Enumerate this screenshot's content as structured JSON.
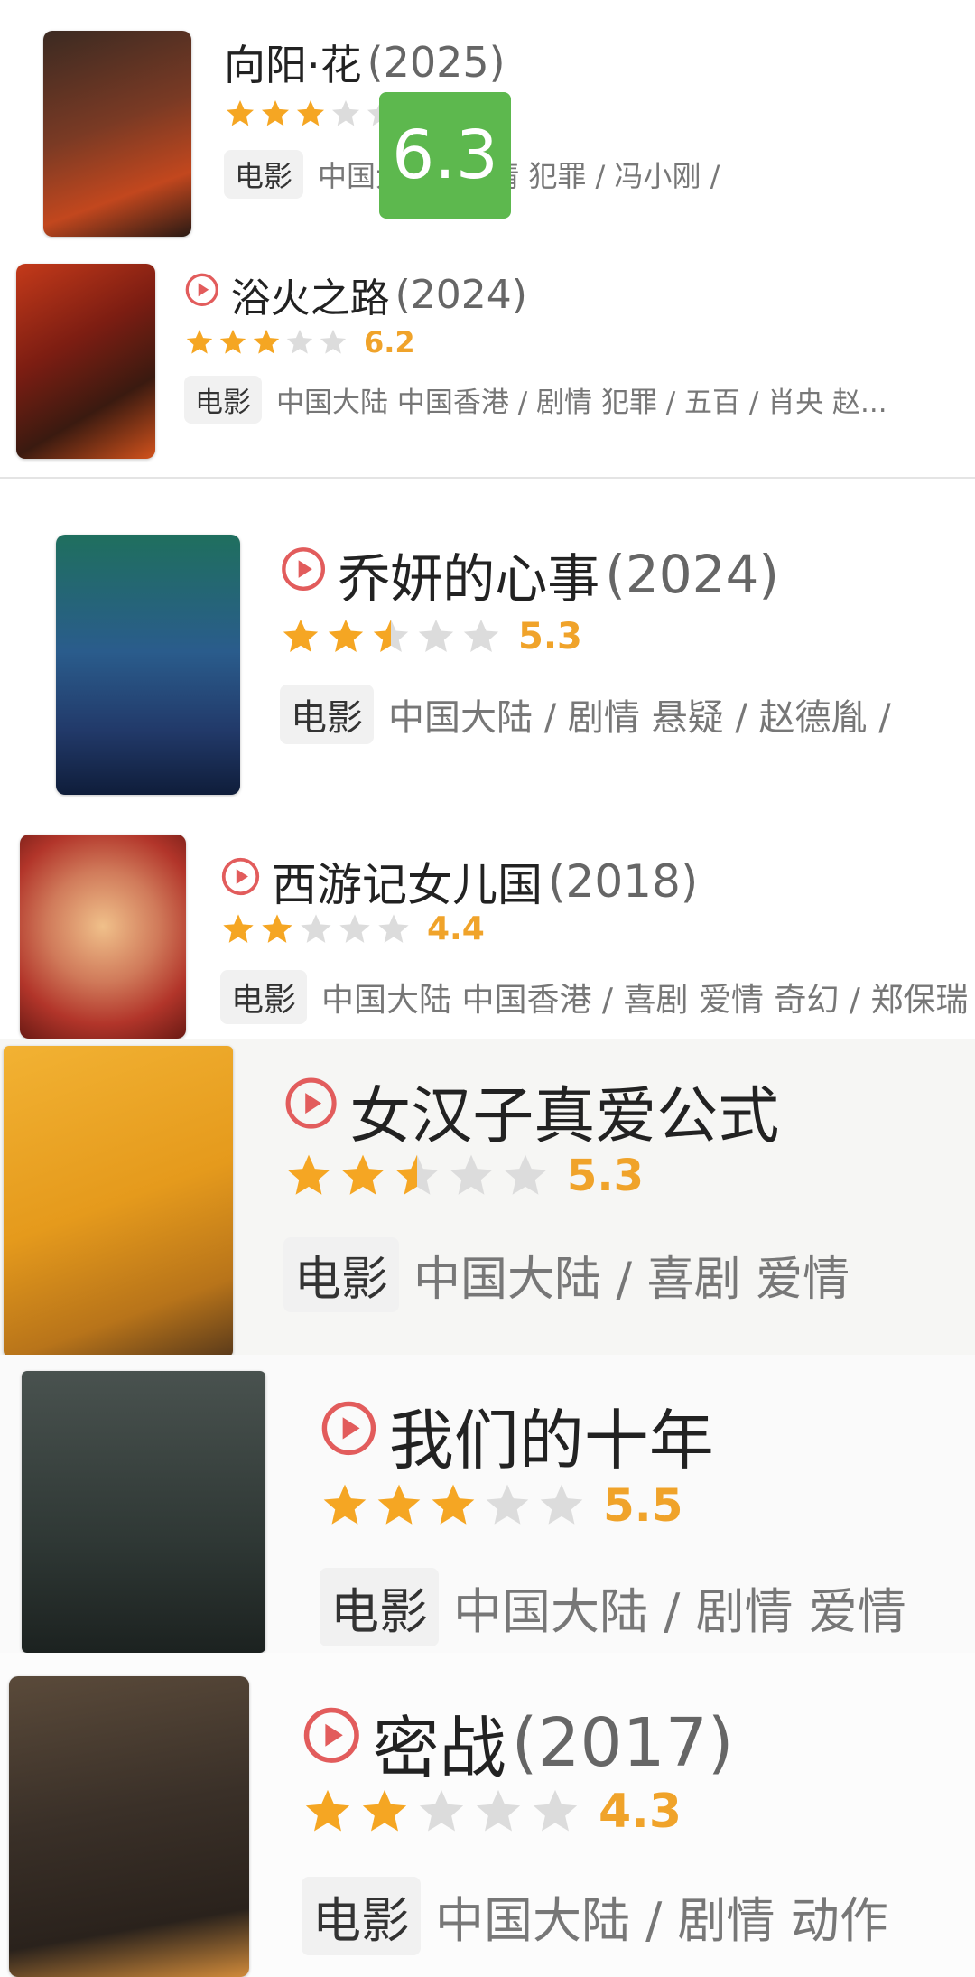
{
  "overlay_score": "6.3",
  "colors": {
    "star_on": "#f5a623",
    "star_off": "#dcdcdc",
    "play": "#e25c5c",
    "score": "#f0a32a"
  },
  "movies": [
    {
      "title": "向阳·花",
      "year": "(2025)",
      "stars": 3,
      "score": "",
      "badge": "电影",
      "meta": "中国大陆 / 剧情 犯罪 / 冯小刚 /",
      "has_play": false
    },
    {
      "title": "浴火之路",
      "year": "(2024)",
      "stars": 3,
      "score": "6.2",
      "badge": "电影",
      "meta": "中国大陆 中国香港 / 剧情 犯罪 / 五百 / 肖央 赵...",
      "has_play": true
    },
    {
      "title": "乔妍的心事",
      "year": "(2024)",
      "stars": 2.5,
      "score": "5.3",
      "badge": "电影",
      "meta": "中国大陆 / 剧情 悬疑 / 赵德胤 /",
      "has_play": true
    },
    {
      "title": "西游记女儿国",
      "year": "(2018)",
      "stars": 2,
      "score": "4.4",
      "badge": "电影",
      "meta": "中国大陆 中国香港 / 喜剧 爱情 奇幻 / 郑保瑞",
      "has_play": true
    },
    {
      "title": "女汉子真爱公式",
      "year": "",
      "stars": 2.5,
      "score": "5.3",
      "badge": "电影",
      "meta": "中国大陆 / 喜剧 爱情",
      "has_play": true
    },
    {
      "title": "我们的十年",
      "year": "",
      "stars": 3,
      "score": "5.5",
      "badge": "电影",
      "meta": "中国大陆 / 剧情 爱情",
      "has_play": true
    },
    {
      "title": "密战",
      "year": "(2017)",
      "stars": 2,
      "score": "4.3",
      "badge": "电影",
      "meta": "中国大陆 / 剧情 动作",
      "has_play": true
    }
  ]
}
